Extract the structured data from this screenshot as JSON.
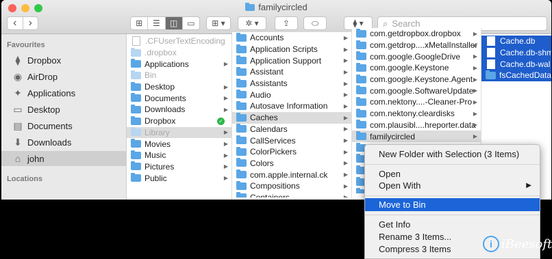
{
  "window": {
    "title": "familycircled"
  },
  "toolbar": {
    "back": "‹",
    "forward": "›",
    "view_icons": [
      "⊞",
      "☰",
      "◫",
      "▭"
    ],
    "group": "⊞ ▾",
    "action": "✲ ▾",
    "share": "⇪",
    "tag": "⬭",
    "dropbox": "⧫ ▾",
    "search_placeholder": "Search"
  },
  "sidebar": {
    "favourites_heading": "Favourites",
    "locations_heading": "Locations",
    "items": [
      {
        "icon": "dropbox-icon",
        "glyph": "⧫",
        "label": "Dropbox"
      },
      {
        "icon": "airdrop-icon",
        "glyph": "◉",
        "label": "AirDrop"
      },
      {
        "icon": "applications-icon",
        "glyph": "✦",
        "label": "Applications"
      },
      {
        "icon": "desktop-icon",
        "glyph": "▭",
        "label": "Desktop"
      },
      {
        "icon": "documents-icon",
        "glyph": "▤",
        "label": "Documents"
      },
      {
        "icon": "downloads-icon",
        "glyph": "⬇",
        "label": "Downloads"
      },
      {
        "icon": "home-icon",
        "glyph": "⌂",
        "label": "john"
      }
    ]
  },
  "col1": [
    {
      "label": ".CFUserTextEncoding",
      "dim": true,
      "type": "doc"
    },
    {
      "label": ".dropbox",
      "dim": true
    },
    {
      "label": "Applications",
      "arrow": true
    },
    {
      "label": "Bin",
      "dim": true
    },
    {
      "label": "Desktop",
      "arrow": true
    },
    {
      "label": "Documents",
      "arrow": true
    },
    {
      "label": "Downloads",
      "arrow": true
    },
    {
      "label": "Dropbox",
      "check": true
    },
    {
      "label": "Library",
      "dim": true,
      "sel": true,
      "arrow": true
    },
    {
      "label": "Movies",
      "arrow": true
    },
    {
      "label": "Music",
      "arrow": true
    },
    {
      "label": "Pictures",
      "arrow": true
    },
    {
      "label": "Public",
      "arrow": true
    }
  ],
  "col2": [
    {
      "label": "Accounts",
      "arrow": true
    },
    {
      "label": "Application Scripts",
      "arrow": true
    },
    {
      "label": "Application Support",
      "arrow": true
    },
    {
      "label": "Assistant",
      "arrow": true
    },
    {
      "label": "Assistants",
      "arrow": true
    },
    {
      "label": "Audio",
      "arrow": true
    },
    {
      "label": "Autosave Information",
      "arrow": true
    },
    {
      "label": "Caches",
      "sel": true,
      "arrow": true
    },
    {
      "label": "Calendars",
      "arrow": true
    },
    {
      "label": "CallServices",
      "arrow": true
    },
    {
      "label": "ColorPickers",
      "arrow": true
    },
    {
      "label": "Colors",
      "arrow": true
    },
    {
      "label": "com.apple.internal.ck",
      "arrow": true
    },
    {
      "label": "Compositions",
      "arrow": true
    },
    {
      "label": "Containers",
      "arrow": true
    }
  ],
  "col3": [
    {
      "label": "com.getdropbox.dropbox",
      "arrow": true
    },
    {
      "label": "com.getdrop....xMetalInstaller",
      "arrow": true
    },
    {
      "label": "com.google.GoogleDrive",
      "arrow": true
    },
    {
      "label": "com.google.Keystone",
      "arrow": true
    },
    {
      "label": "com.google.Keystone.Agent",
      "arrow": true
    },
    {
      "label": "com.google.SoftwareUpdate",
      "arrow": true
    },
    {
      "label": "com.nektony....-Cleaner-Pro",
      "arrow": true
    },
    {
      "label": "com.nektony.cleardisks",
      "arrow": true
    },
    {
      "label": "com.plausibl....hreporter.data",
      "arrow": true
    },
    {
      "label": "familycircled",
      "sel": true,
      "arrow": true
    },
    {
      "label": ""
    },
    {
      "label": ""
    },
    {
      "label": ""
    },
    {
      "label": ""
    },
    {
      "label": ""
    }
  ],
  "col4": [
    {
      "label": "Cache.db",
      "hl": true,
      "type": "doc"
    },
    {
      "label": "Cache.db-shm",
      "hl": true,
      "type": "doc"
    },
    {
      "label": "Cache.db-wal",
      "hl": true,
      "type": "doc"
    },
    {
      "label": "fsCachedData",
      "hl": true
    }
  ],
  "context_menu": {
    "new_folder": "New Folder with Selection (3 Items)",
    "open": "Open",
    "open_with": "Open With",
    "open_with_arrow": "▶",
    "move_to_bin": "Move to Bin",
    "get_info": "Get Info",
    "rename": "Rename 3 Items...",
    "compress": "Compress 3 Items"
  },
  "watermark": {
    "badge": "i",
    "text": "iBeesoft"
  },
  "colors": {
    "selection": "#1c65d8",
    "folder": "#5aa6e6",
    "close": "#fc605c",
    "minimize": "#fdbc40",
    "zoom": "#34c84a"
  }
}
